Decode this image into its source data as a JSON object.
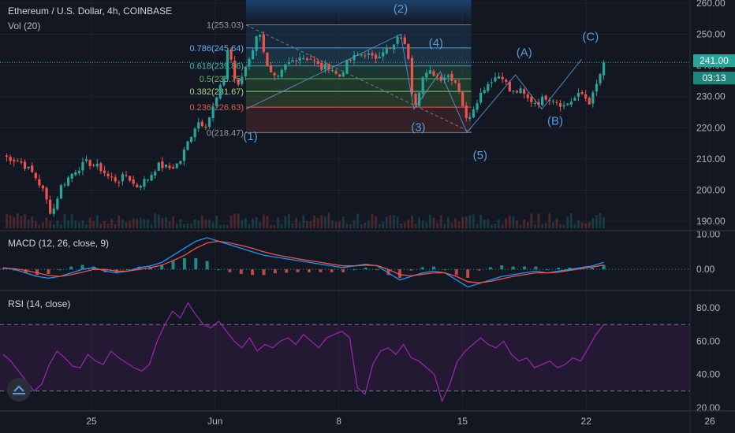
{
  "header": {
    "title": "Ethereum / U.S. Dollar, 4h, COINBASE",
    "volume_label": "Vol (20)"
  },
  "indicators": {
    "macd_label": "MACD (12, 26, close, 9)",
    "rsi_label": "RSI (14, close)"
  },
  "price_tag": {
    "price": "241.00",
    "countdown": "03:13"
  },
  "colors": {
    "up": "#26a69a",
    "down": "#ef5350",
    "wave": "#5b9bd5",
    "macd": "#2196f3",
    "signal": "#ef5350",
    "rsi": "#9c27b0"
  },
  "chart_data": [
    {
      "type": "candlestick",
      "title": "Ethereum / U.S. Dollar, 4h, COINBASE",
      "x_ticks": [
        "25",
        "Jun",
        "8",
        "15",
        "22",
        "26"
      ],
      "y_ticks": [
        "190.00",
        "200.00",
        "210.00",
        "220.00",
        "230.00",
        "240.00",
        "250.00",
        "260.00"
      ],
      "ylim": [
        187,
        261
      ],
      "last_price": 241.0,
      "close_path": [
        [
          0,
          211
        ],
        [
          4,
          209
        ],
        [
          7,
          205
        ],
        [
          9,
          200
        ],
        [
          11,
          192
        ],
        [
          13,
          201
        ],
        [
          16,
          206
        ],
        [
          19,
          209
        ],
        [
          22,
          207
        ],
        [
          24,
          204
        ],
        [
          26,
          203
        ],
        [
          28,
          205
        ],
        [
          30,
          201
        ],
        [
          33,
          204
        ],
        [
          35,
          208
        ],
        [
          38,
          207
        ],
        [
          40,
          209
        ],
        [
          42,
          216
        ],
        [
          44,
          222
        ],
        [
          46,
          221
        ],
        [
          48,
          228
        ],
        [
          50,
          236
        ],
        [
          51,
          247
        ],
        [
          52,
          239
        ],
        [
          53,
          232
        ],
        [
          55,
          240
        ],
        [
          57,
          247
        ],
        [
          58,
          252
        ],
        [
          60,
          238
        ],
        [
          62,
          235
        ],
        [
          64,
          240
        ],
        [
          67,
          243
        ],
        [
          70,
          242
        ],
        [
          72,
          239
        ],
        [
          74,
          240
        ],
        [
          76,
          236
        ],
        [
          78,
          241
        ],
        [
          80,
          243
        ],
        [
          82,
          244
        ],
        [
          84,
          242
        ],
        [
          86,
          245
        ],
        [
          88,
          245
        ],
        [
          90,
          250
        ],
        [
          92,
          242
        ],
        [
          93,
          226
        ],
        [
          95,
          236
        ],
        [
          97,
          238
        ],
        [
          99,
          236
        ],
        [
          101,
          237
        ],
        [
          103,
          234
        ],
        [
          105,
          222
        ],
        [
          107,
          228
        ],
        [
          109,
          233
        ],
        [
          111,
          236
        ],
        [
          113,
          237
        ],
        [
          115,
          231
        ],
        [
          117,
          232
        ],
        [
          119,
          229
        ],
        [
          121,
          228
        ],
        [
          123,
          230
        ],
        [
          125,
          229
        ],
        [
          127,
          227
        ],
        [
          129,
          229
        ],
        [
          131,
          231
        ],
        [
          133,
          228
        ],
        [
          135,
          236
        ],
        [
          136,
          241
        ]
      ],
      "fibonacci": [
        {
          "label": "1(253.03)",
          "price": 253.03
        },
        {
          "label": "0.786(245.64)",
          "price": 245.64
        },
        {
          "label": "0.618(239.86)",
          "price": 239.86
        },
        {
          "label": "0.5(235.75)",
          "price": 235.75
        },
        {
          "label": "0.382(231.67)",
          "price": 231.67
        },
        {
          "label": "0.236(226.63)",
          "price": 226.63
        },
        {
          "label": "0(218.47)",
          "price": 218.47
        }
      ],
      "wave_labels": [
        {
          "text": "(1)",
          "x": 56,
          "y": 216
        },
        {
          "text": "(2)",
          "x": 90,
          "y": 257
        },
        {
          "text": "(3)",
          "x": 94,
          "y": 219
        },
        {
          "text": "(4)",
          "x": 98,
          "y": 246
        },
        {
          "text": "(5)",
          "x": 108,
          "y": 210
        },
        {
          "text": "(A)",
          "x": 118,
          "y": 243
        },
        {
          "text": "(B)",
          "x": 125,
          "y": 221
        },
        {
          "text": "(C)",
          "x": 133,
          "y": 248
        }
      ]
    },
    {
      "type": "line",
      "title": "MACD (12, 26, close, 9)",
      "y_ticks": [
        "0.00",
        "10.00"
      ],
      "ylim": [
        -6,
        11
      ],
      "series": [
        {
          "name": "MACD",
          "values": [
            0.5,
            0,
            -1,
            -2,
            -2.5,
            -2,
            -1,
            0,
            0.5,
            -0.5,
            -1,
            -0.5,
            0.5,
            1,
            2,
            4,
            6,
            8,
            9,
            8,
            7,
            6,
            5,
            4,
            3.5,
            3,
            2.5,
            2,
            1.5,
            1,
            0.5,
            1,
            1.5,
            1,
            -1,
            -3,
            -2,
            -1,
            -0.5,
            -1,
            -3,
            -5,
            -4,
            -3,
            -2,
            -1.5,
            -1,
            -0.5,
            -1,
            -0.5,
            0,
            0.5,
            1,
            2
          ]
        },
        {
          "name": "Signal",
          "values": [
            0.3,
            0.2,
            -0.3,
            -1,
            -1.7,
            -2,
            -1.5,
            -0.8,
            0,
            0,
            -0.5,
            -0.5,
            0,
            0.5,
            1.2,
            2.5,
            4,
            6,
            7.5,
            8,
            7.5,
            6.8,
            6,
            5,
            4.2,
            3.6,
            3,
            2.5,
            2,
            1.5,
            1,
            1,
            1.2,
            1.1,
            0,
            -1.5,
            -1.8,
            -1.4,
            -1,
            -1,
            -2,
            -3.5,
            -3.8,
            -3.4,
            -2.7,
            -2,
            -1.5,
            -1,
            -1,
            -0.8,
            -0.3,
            0.2,
            0.7,
            1.2
          ]
        }
      ]
    },
    {
      "type": "line",
      "title": "RSI (14, close)",
      "y_ticks": [
        "20.00",
        "40.00",
        "60.00",
        "80.00"
      ],
      "ylim": [
        18,
        90
      ],
      "bands": [
        30,
        70
      ],
      "series": [
        {
          "name": "RSI",
          "values": [
            52,
            48,
            42,
            36,
            30,
            34,
            46,
            54,
            50,
            45,
            44,
            52,
            48,
            46,
            54,
            50,
            47,
            44,
            42,
            46,
            60,
            70,
            78,
            74,
            83,
            76,
            70,
            68,
            72,
            66,
            60,
            56,
            62,
            54,
            58,
            56,
            60,
            62,
            58,
            64,
            60,
            56,
            62,
            64,
            66,
            62,
            32,
            28,
            46,
            54,
            56,
            52,
            58,
            50,
            48,
            44,
            40,
            24,
            34,
            48,
            54,
            58,
            62,
            58,
            56,
            60,
            52,
            48,
            50,
            44,
            46,
            48,
            44,
            46,
            50,
            48,
            56,
            64,
            70
          ]
        }
      ]
    }
  ]
}
